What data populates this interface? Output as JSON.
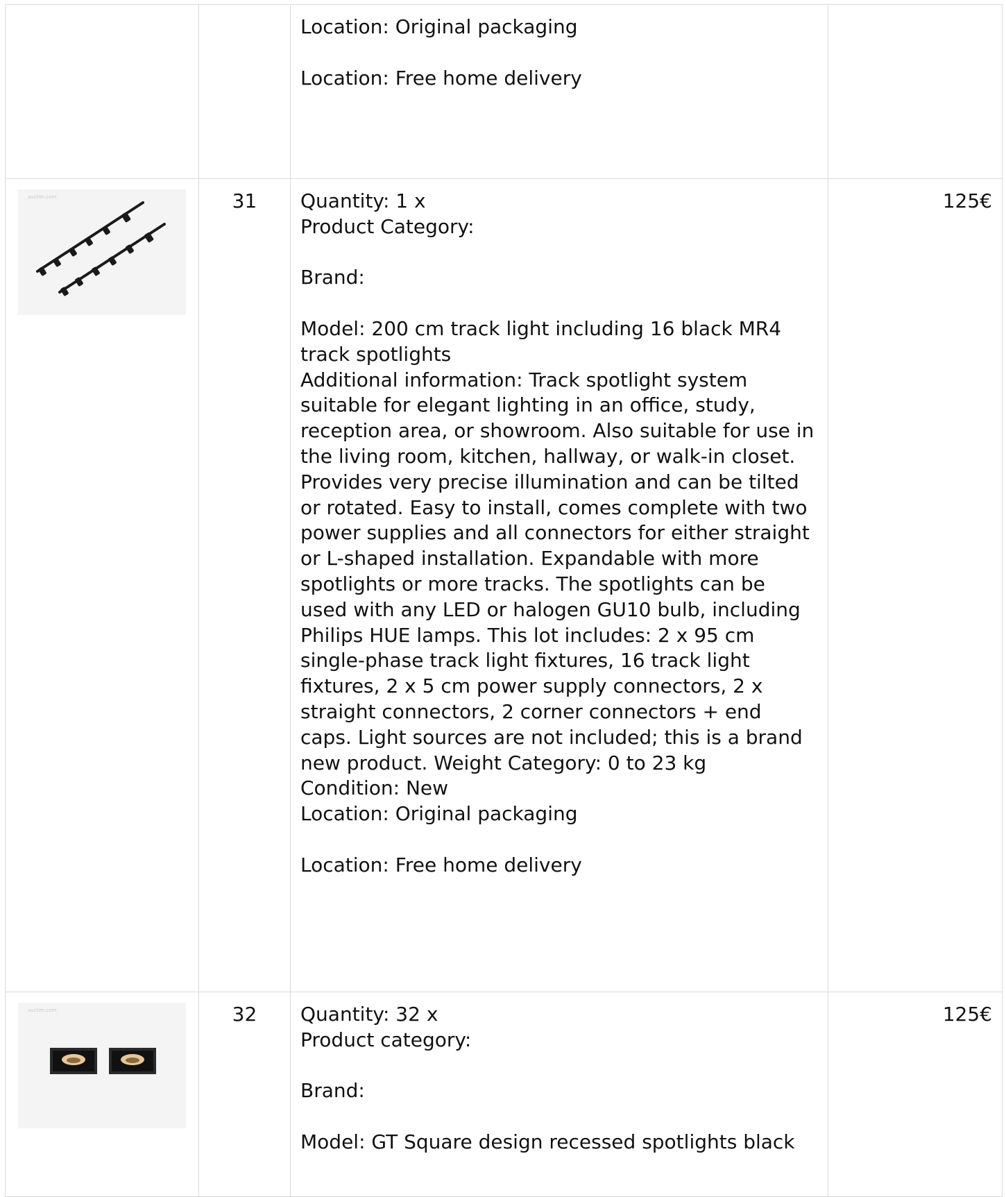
{
  "rows": [
    {
      "lot": "",
      "price": "",
      "description": [
        "Location: Original packaging",
        "",
        "Location: Free home delivery"
      ]
    },
    {
      "lot": "31",
      "price": "125€",
      "image_icon": "track-light-image",
      "image_watermark": "auctim.com",
      "description": [
        "Quantity: 1 x",
        "Product Category:",
        "",
        "Brand:",
        "",
        "Model: 200 cm track light including 16 black MR4 track spotlights",
        "Additional information: Track spotlight system suitable for elegant lighting in an office, study, reception area, or showroom. Also suitable for use in the living room, kitchen, hallway, or walk-in closet. Provides very precise illumination and can be tilted or rotated. Easy to install, comes complete with two power supplies and all connectors for either straight or L-shaped installation. Expandable with more spotlights or more tracks. The spotlights can be used with any LED or halogen GU10 bulb, including Philips HUE lamps. This lot includes: 2 x 95 cm single-phase track light fixtures, 16 track light fixtures, 2 x 5 cm power supply connectors, 2 x straight connectors, 2 corner connectors + end caps. Light sources are not included; this is a brand new product. Weight Category: 0 to 23 kg",
        "Condition: New",
        "Location: Original packaging",
        "",
        "Location: Free home delivery"
      ]
    },
    {
      "lot": "32",
      "price": "125€",
      "image_icon": "recessed-spotlight-image",
      "image_watermark": "auctim.com",
      "description": [
        "Quantity: 32 x",
        "Product category:",
        "",
        "Brand:",
        "",
        "Model: GT Square design recessed spotlights black"
      ]
    }
  ]
}
